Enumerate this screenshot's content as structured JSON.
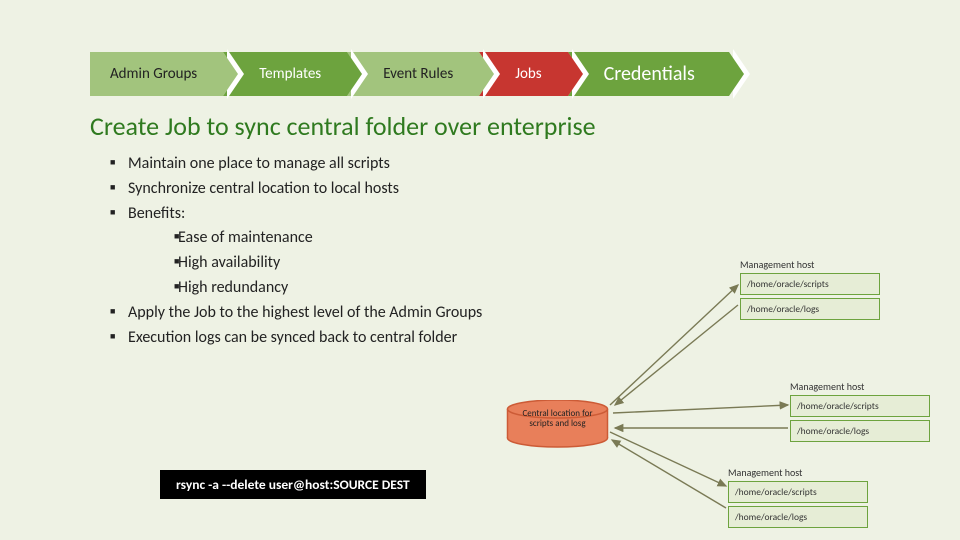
{
  "steps": {
    "s1": "Admin Groups",
    "s2": "Templates",
    "s3": "Event Rules",
    "s4": "Jobs",
    "s5": "Credentials"
  },
  "heading": "Create Job to sync central folder over enterprise",
  "bullets": {
    "b1": "Maintain one place to manage all scripts",
    "b2": "Synchronize central location to local hosts",
    "b3": "Benefits:",
    "b3a": "Ease of maintenance",
    "b3b": "High availability",
    "b3c": "High redundancy",
    "b4": "Apply the Job to the highest level of the Admin Groups",
    "b5": "Execution logs can be synced back to central folder"
  },
  "host_label": "Management host",
  "path_scripts": "/home/oracle/scripts",
  "path_logs": "/home/oracle/logs",
  "cylinder": {
    "line1": "Central location for",
    "line2": "scripts and losg"
  },
  "cmd": "rsync -a --delete user@host:SOURCE DEST"
}
